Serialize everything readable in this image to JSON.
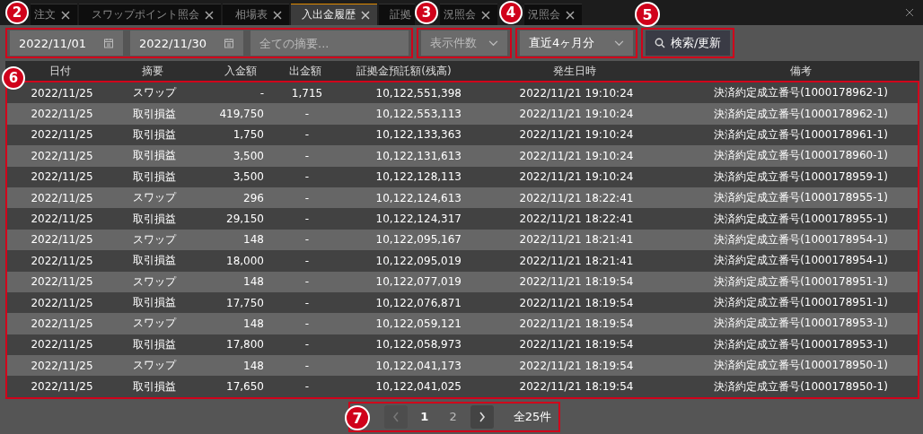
{
  "tabs": [
    {
      "label": "注文",
      "selected": false
    },
    {
      "label": "スワップポイント照会",
      "selected": false
    },
    {
      "label": "相場表",
      "selected": false
    },
    {
      "label": "入出金履歴",
      "selected": true
    },
    {
      "label": "証拠",
      "label_end": "況照会",
      "selected": false
    },
    {
      "label": "況照会",
      "selected": false
    }
  ],
  "filters": {
    "date_from": "2022/11/01",
    "date_to": "2022/11/30",
    "summary_placeholder": "全ての摘要...",
    "count_placeholder": "表示件数",
    "period": "直近4ヶ月分",
    "search_button": "検索/更新"
  },
  "table": {
    "columns": [
      "日付",
      "摘要",
      "入金額",
      "出金額",
      "証拠金預託額(残高)",
      "発生日時",
      "備考"
    ],
    "rows": [
      [
        "2022/11/25",
        "スワップ",
        "-",
        "1,715",
        "10,122,551,398",
        "2022/11/21 19:10:24",
        "決済約定成立番号(1000178962-1)"
      ],
      [
        "2022/11/25",
        "取引損益",
        "419,750",
        "-",
        "10,122,553,113",
        "2022/11/21 19:10:24",
        "決済約定成立番号(1000178962-1)"
      ],
      [
        "2022/11/25",
        "取引損益",
        "1,750",
        "-",
        "10,122,133,363",
        "2022/11/21 19:10:24",
        "決済約定成立番号(1000178961-1)"
      ],
      [
        "2022/11/25",
        "取引損益",
        "3,500",
        "-",
        "10,122,131,613",
        "2022/11/21 19:10:24",
        "決済約定成立番号(1000178960-1)"
      ],
      [
        "2022/11/25",
        "取引損益",
        "3,500",
        "-",
        "10,122,128,113",
        "2022/11/21 19:10:24",
        "決済約定成立番号(1000178959-1)"
      ],
      [
        "2022/11/25",
        "スワップ",
        "296",
        "-",
        "10,122,124,613",
        "2022/11/21 18:22:41",
        "決済約定成立番号(1000178955-1)"
      ],
      [
        "2022/11/25",
        "取引損益",
        "29,150",
        "-",
        "10,122,124,317",
        "2022/11/21 18:22:41",
        "決済約定成立番号(1000178955-1)"
      ],
      [
        "2022/11/25",
        "スワップ",
        "148",
        "-",
        "10,122,095,167",
        "2022/11/21 18:21:41",
        "決済約定成立番号(1000178954-1)"
      ],
      [
        "2022/11/25",
        "取引損益",
        "18,000",
        "-",
        "10,122,095,019",
        "2022/11/21 18:21:41",
        "決済約定成立番号(1000178954-1)"
      ],
      [
        "2022/11/25",
        "スワップ",
        "148",
        "-",
        "10,122,077,019",
        "2022/11/21 18:19:54",
        "決済約定成立番号(1000178951-1)"
      ],
      [
        "2022/11/25",
        "取引損益",
        "17,750",
        "-",
        "10,122,076,871",
        "2022/11/21 18:19:54",
        "決済約定成立番号(1000178951-1)"
      ],
      [
        "2022/11/25",
        "スワップ",
        "148",
        "-",
        "10,122,059,121",
        "2022/11/21 18:19:54",
        "決済約定成立番号(1000178953-1)"
      ],
      [
        "2022/11/25",
        "取引損益",
        "17,800",
        "-",
        "10,122,058,973",
        "2022/11/21 18:19:54",
        "決済約定成立番号(1000178953-1)"
      ],
      [
        "2022/11/25",
        "スワップ",
        "148",
        "-",
        "10,122,041,173",
        "2022/11/21 18:19:54",
        "決済約定成立番号(1000178950-1)"
      ],
      [
        "2022/11/25",
        "取引損益",
        "17,650",
        "-",
        "10,122,041,025",
        "2022/11/21 18:19:54",
        "決済約定成立番号(1000178950-1)"
      ]
    ]
  },
  "pagination": {
    "pages": [
      {
        "label": "1",
        "selected": true
      },
      {
        "label": "2",
        "selected": false
      }
    ],
    "prev_disabled": true,
    "next_disabled": false,
    "total": "全25件"
  },
  "callouts": [
    "2",
    "3",
    "4",
    "5",
    "6",
    "7"
  ]
}
